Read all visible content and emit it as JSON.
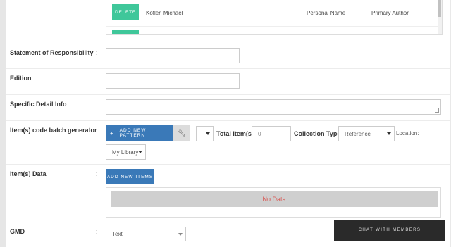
{
  "authors": {
    "rows": [
      {
        "delete_label": "DELETE",
        "name": "Kofler, Michael",
        "type": "Personal Name",
        "role": "Primary Author"
      }
    ]
  },
  "fields": {
    "statement": {
      "label": "Statement of Responsibility",
      "value": ""
    },
    "edition": {
      "label": "Edition",
      "value": ""
    },
    "specific_detail": {
      "label": "Specific Detail Info",
      "value": ""
    },
    "batch": {
      "label": "Item(s) code batch generator",
      "add_pattern": "ADD NEW PATTERN",
      "total_items_label": "Total item(s):",
      "total_items_value": "0",
      "collection_type_label": "Collection Type:",
      "collection_type_value": "Reference",
      "location_label": "Location:",
      "location_value": "My Library"
    },
    "items_data": {
      "label": "Item(s) Data",
      "add_items": "ADD NEW ITEMS",
      "no_data": "No Data"
    },
    "gmd": {
      "label": "GMD",
      "value": "Text"
    }
  },
  "colon": ":",
  "chat": {
    "label": "CHAT WITH MEMBERS"
  },
  "colors": {
    "green": "#3fc79a",
    "blue": "#3a79b8",
    "no_data_text": "#d9534f",
    "chat_bg": "#2a2a2a"
  }
}
